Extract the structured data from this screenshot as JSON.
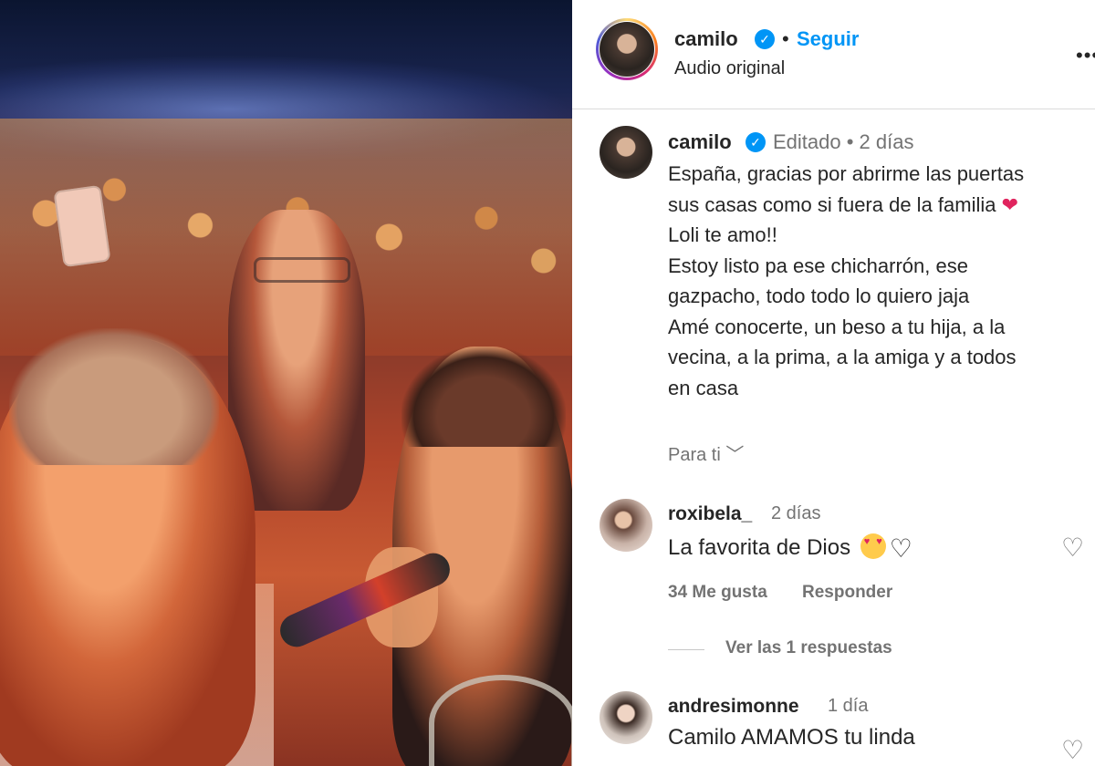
{
  "header": {
    "username": "camilo",
    "verified_icon": "verified-badge-icon",
    "separator": "•",
    "follow_label": "Seguir",
    "subtitle": "Audio original",
    "more_icon": "more-options-icon",
    "more_glyph": "•••"
  },
  "caption": {
    "username": "camilo",
    "meta": "Editado •  2 días",
    "lines": [
      "España, gracias por abrirme las puertas",
      "sus casas como si fuera de la familia",
      "Loli te amo!!",
      "Estoy listo pa ese chicharrón, ese",
      "gazpacho, todo todo lo quiero jaja",
      "Amé conocerte, un beso a tu hija, a la",
      "vecina, a la prima, a la amiga y a todos",
      "en casa"
    ],
    "heart_emoji": "❤",
    "for_you_label": "Para ti ﹀"
  },
  "comments": [
    {
      "username": "roxibela_",
      "time": "2 días",
      "text": "La favorita de Dios",
      "outline_heart": "♡",
      "likes": "34 Me gusta",
      "reply_label": "Responder",
      "view_replies": "Ver las 1 respuestas",
      "like_glyph": "♡"
    },
    {
      "username": "andresimonne",
      "time": "1 día",
      "text": "Camilo AMAMOS tu linda",
      "like_glyph": "♡"
    }
  ],
  "colors": {
    "accent": "#0095f6",
    "text": "#262626",
    "muted": "#737373",
    "heart_red": "#e0245e"
  }
}
